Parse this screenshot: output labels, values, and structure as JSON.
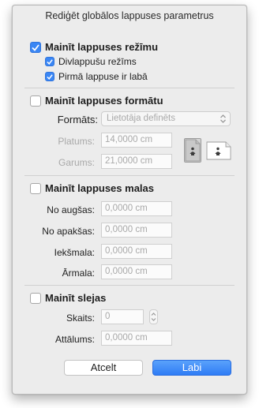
{
  "window": {
    "title": "Rediģēt globālos lappuses parametrus"
  },
  "mode": {
    "heading": "Mainīt lappuses režīmu",
    "checked": true,
    "options": [
      {
        "label": "Divlappušu režīms",
        "checked": true
      },
      {
        "label": "Pirmā lappuse ir labā",
        "checked": true
      }
    ]
  },
  "format": {
    "heading": "Mainīt lappuses formātu",
    "checked": false,
    "format_label": "Formāts:",
    "format_value": "Lietotāja definēts",
    "width_label": "Platums:",
    "width_value": "14,0000 cm",
    "height_label": "Garums:",
    "height_value": "21,0000 cm",
    "orientation_selected": "portrait"
  },
  "margins": {
    "heading": "Mainīt lappuses malas",
    "checked": false,
    "top_label": "No augšas:",
    "top_value": "0,0000 cm",
    "bottom_label": "No apakšas:",
    "bottom_value": "0,0000 cm",
    "inner_label": "Iekšmala:",
    "inner_value": "0,0000 cm",
    "outer_label": "Ārmala:",
    "outer_value": "0,0000 cm"
  },
  "columns": {
    "heading": "Mainīt slejas",
    "checked": false,
    "count_label": "Skaits:",
    "count_value": "0",
    "gap_label": "Attālums:",
    "gap_value": "0,0000 cm"
  },
  "buttons": {
    "cancel": "Atcelt",
    "ok": "Labi"
  },
  "colors": {
    "accent": "#3a86f4",
    "dialog_bg": "#ececec"
  }
}
